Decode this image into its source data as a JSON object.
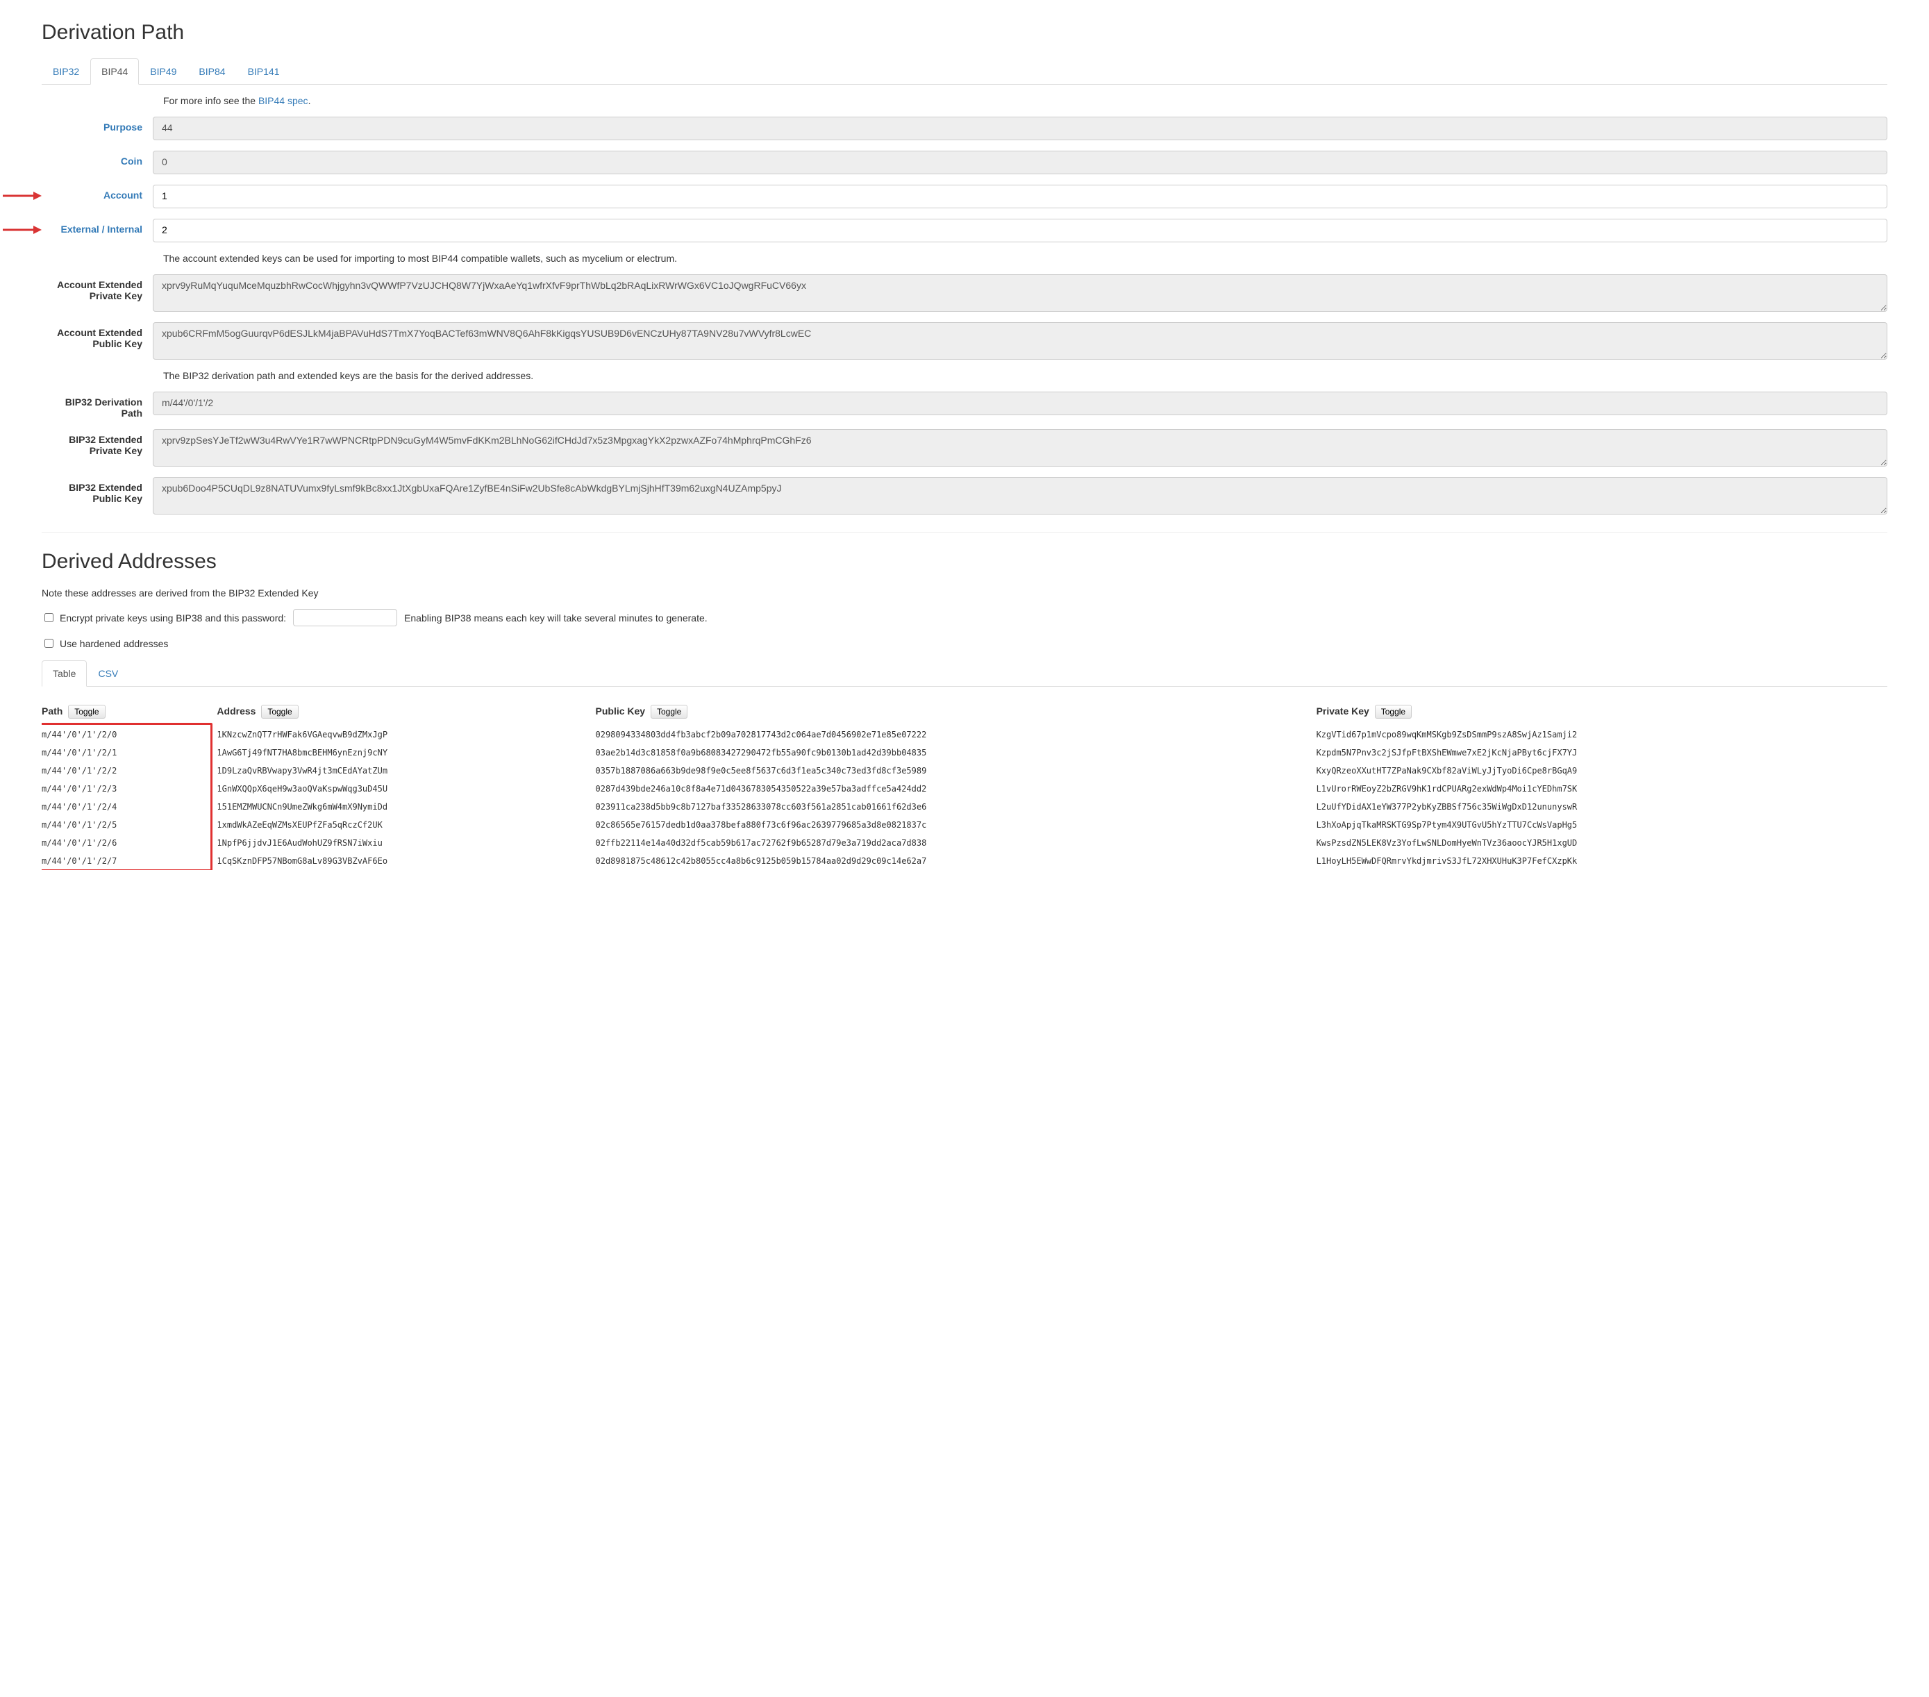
{
  "heading_dp": "Derivation Path",
  "tabs": {
    "bip32": "BIP32",
    "bip44": "BIP44",
    "bip49": "BIP49",
    "bip84": "BIP84",
    "bip141": "BIP141"
  },
  "info_prefix": "For more info see the ",
  "info_link": "BIP44 spec",
  "info_suffix": ".",
  "labels": {
    "purpose": "Purpose",
    "coin": "Coin",
    "account": "Account",
    "ext_int": "External / Internal",
    "acct_xprv": "Account Extended Private Key",
    "acct_xpub": "Account Extended Public Key",
    "bip32_path": "BIP32 Derivation Path",
    "bip32_xprv": "BIP32 Extended Private Key",
    "bip32_xpub": "BIP32 Extended Public Key"
  },
  "values": {
    "purpose": "44",
    "coin": "0",
    "account": "1",
    "ext_int": "2",
    "acct_note": "The account extended keys can be used for importing to most BIP44 compatible wallets, such as mycelium or electrum.",
    "acct_xprv": "xprv9yRuMqYuquMceMquzbhRwCocWhjgyhn3vQWWfP7VzUJCHQ8W7YjWxaAeYq1wfrXfvF9prThWbLq2bRAqLixRWrWGx6VC1oJQwgRFuCV66yx",
    "acct_xpub": "xpub6CRFmM5ogGuurqvP6dESJLkM4jaBPAVuHdS7TmX7YoqBACTef63mWNV8Q6AhF8kKigqsYUSUB9D6vENCzUHy87TA9NV28u7vWVyfr8LcwEC",
    "path_note": "The BIP32 derivation path and extended keys are the basis for the derived addresses.",
    "bip32_path": "m/44'/0'/1'/2",
    "bip32_xprv": "xprv9zpSesYJeTf2wW3u4RwVYe1R7wWPNCRtpPDN9cuGyM4W5mvFdKKm2BLhNoG62ifCHdJd7x5z3MpgxagYkX2pzwxAZFo74hMphrqPmCGhFz6",
    "bip32_xpub": "xpub6Doo4P5CUqDL9z8NATUVumx9fyLsmf9kBc8xx1JtXgbUxaFQAre1ZyfBE4nSiFw2UbSfe8cAbWkdgBYLmjSjhHfT39m62uxgN4UZAmp5pyJ"
  },
  "heading_da": "Derived Addresses",
  "da_note": "Note these addresses are derived from the BIP32 Extended Key",
  "bip38": {
    "label_before": "Encrypt private keys using BIP38 and this password:",
    "label_after": "Enabling BIP38 means each key will take several minutes to generate."
  },
  "hardened_label": "Use hardened addresses",
  "addr_tabs": {
    "table": "Table",
    "csv": "CSV"
  },
  "toggle_label": "Toggle",
  "table_headers": {
    "path": "Path",
    "address": "Address",
    "pubkey": "Public Key",
    "privkey": "Private Key"
  },
  "rows": [
    {
      "path": "m/44'/0'/1'/2/0",
      "address": "1KNzcwZnQT7rHWFak6VGAeqvwB9dZMxJgP",
      "pubkey": "0298094334803dd4fb3abcf2b09a702817743d2c064ae7d0456902e71e85e07222",
      "privkey": "KzgVTid67p1mVcpo89wqKmMSKgb9ZsDSmmP9szA8SwjAz1Samji2"
    },
    {
      "path": "m/44'/0'/1'/2/1",
      "address": "1AwG6Tj49fNT7HA8bmcBEHM6ynEznj9cNY",
      "pubkey": "03ae2b14d3c81858f0a9b68083427290472fb55a90fc9b0130b1ad42d39bb04835",
      "privkey": "Kzpdm5N7Pnv3c2jSJfpFtBXShEWmwe7xE2jKcNjaPByt6cjFX7YJ"
    },
    {
      "path": "m/44'/0'/1'/2/2",
      "address": "1D9LzaQvRBVwapy3VwR4jt3mCEdAYatZUm",
      "pubkey": "0357b1887086a663b9de98f9e0c5ee8f5637c6d3f1ea5c340c73ed3fd8cf3e5989",
      "privkey": "KxyQRzeoXXutHT7ZPaNak9CXbf82aViWLyJjTyoDi6Cpe8rBGqA9"
    },
    {
      "path": "m/44'/0'/1'/2/3",
      "address": "1GnWXQQpX6qeH9w3aoQVaKspwWqg3uD45U",
      "pubkey": "0287d439bde246a10c8f8a4e71d0436783054350522a39e57ba3adffce5a424dd2",
      "privkey": "L1vUrorRWEoyZ2bZRGV9hK1rdCPUARg2exWdWp4Moi1cYEDhm7SK"
    },
    {
      "path": "m/44'/0'/1'/2/4",
      "address": "151EMZMWUCNCn9UmeZWkg6mW4mX9NymiDd",
      "pubkey": "023911ca238d5bb9c8b7127baf33528633078cc603f561a2851cab01661f62d3e6",
      "privkey": "L2uUfYDidAX1eYW377P2ybKyZBBSf756c35WiWgDxD12ununyswR"
    },
    {
      "path": "m/44'/0'/1'/2/5",
      "address": "1xmdWkAZeEqWZMsXEUPfZFa5qRczCf2UK",
      "pubkey": "02c86565e76157dedb1d0aa378befa880f73c6f96ac2639779685a3d8e0821837c",
      "privkey": "L3hXoApjqTkaMRSKTG9Sp7Ptym4X9UTGvU5hYzTTU7CcWsVapHg5"
    },
    {
      "path": "m/44'/0'/1'/2/6",
      "address": "1NpfP6jjdvJ1E6AudWohUZ9fRSN7iWxiu",
      "pubkey": "02ffb22114e14a40d32df5cab59b617ac72762f9b65287d79e3a719dd2aca7d838",
      "privkey": "KwsPzsdZN5LEK8Vz3YofLwSNLDomHyeWnTVz36aoocYJR5H1xgUD"
    },
    {
      "path": "m/44'/0'/1'/2/7",
      "address": "1CqSKznDFP57NBomG8aLv89G3VBZvAF6Eo",
      "pubkey": "02d8981875c48612c42b8055cc4a8b6c9125b059b15784aa02d9d29c09c14e62a7",
      "privkey": "L1HoyLH5EWwDFQRmrvYkdjmrivS3JfL72XHXUHuK3P7FefCXzpKk"
    }
  ]
}
